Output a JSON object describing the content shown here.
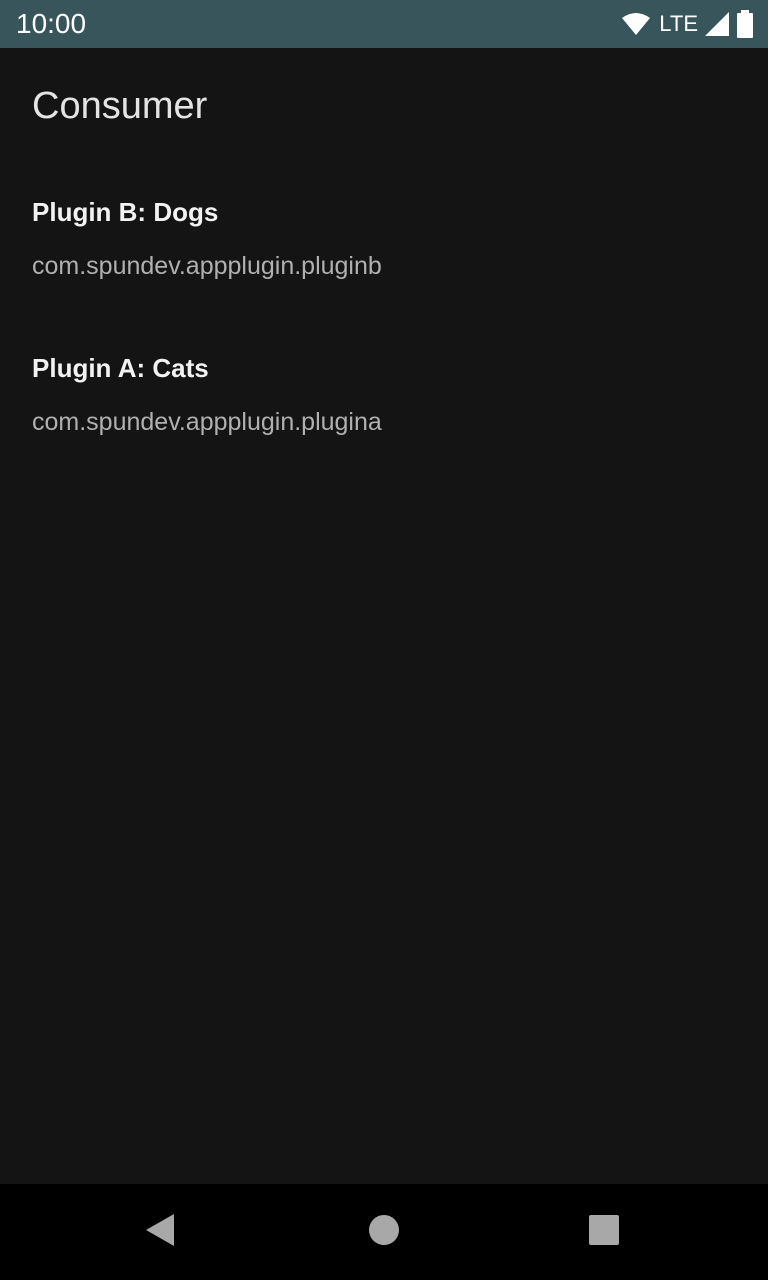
{
  "status_bar": {
    "time": "10:00",
    "network_label": "LTE",
    "icons": [
      "wifi-icon",
      "signal-icon",
      "battery-icon"
    ]
  },
  "app": {
    "title": "Consumer"
  },
  "plugins": [
    {
      "name": "Plugin B: Dogs",
      "package": "com.spundev.appplugin.pluginb"
    },
    {
      "name": "Plugin A: Cats",
      "package": "com.spundev.appplugin.plugina"
    }
  ],
  "nav_bar": {
    "icons": [
      "back-icon",
      "home-icon",
      "recents-icon"
    ]
  },
  "colors": {
    "status_bar_bg": "#37555a",
    "background": "#141414",
    "nav_bar_bg": "#000000"
  }
}
